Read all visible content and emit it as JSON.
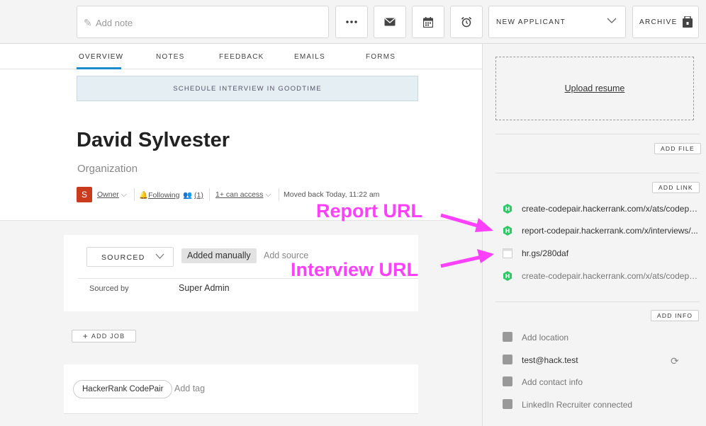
{
  "toolbar": {
    "note_placeholder": "Add note",
    "icons": [
      "more-icon",
      "email-icon",
      "calendar-icon",
      "alarm-icon"
    ],
    "stage_label": "NEW APPLICANT",
    "archive_label": "ARCHIVE"
  },
  "tabs": [
    {
      "label": "OVERVIEW",
      "active": true
    },
    {
      "label": "NOTES"
    },
    {
      "label": "FEEDBACK"
    },
    {
      "label": "EMAILS"
    },
    {
      "label": "FORMS"
    }
  ],
  "schedule_button": "SCHEDULE INTERVIEW IN GOODTIME",
  "candidate": {
    "name": "David Sylvester",
    "organization": "Organization",
    "avatar_initial": "S",
    "owner": "Owner",
    "following": "Following",
    "followers_count": "(1)",
    "access": "1+ can access",
    "moved": "Moved back Today, 11:22 am"
  },
  "source": {
    "stage": "SOURCED",
    "added": "Added manually",
    "add_source": "Add source",
    "sourced_by_label": "Sourced by",
    "sourced_by_value": "Super Admin"
  },
  "add_job": "ADD JOB",
  "tags": {
    "items": [
      "HackerRank CodePair"
    ],
    "add_tag": "Add tag"
  },
  "side": {
    "upload": "Upload resume",
    "add_file": "ADD FILE",
    "add_link": "ADD LINK",
    "links": [
      {
        "text": "create-codepair.hackerrank.com/x/ats/codepair/..."
      },
      {
        "text": "report-codepair.hackerrank.com/x/interviews/..."
      },
      {
        "text": "hr.gs/280daf"
      },
      {
        "text": "create-codepair.hackerrank.com/x/ats/codepair/..."
      }
    ],
    "add_info": "ADD INFO",
    "info": {
      "location": "Add location",
      "email": "test@hack.test",
      "contact": "Add contact info",
      "linkedin": "LinkedIn Recruiter connected"
    }
  },
  "annotations": {
    "report_url": "Report URL",
    "interview_url": "Interview URL",
    "color": "#ff40ff"
  },
  "colors": {
    "accent": "#1a8ccc",
    "avatar": "#c93b1c",
    "hackerrank": "#2ec866"
  }
}
